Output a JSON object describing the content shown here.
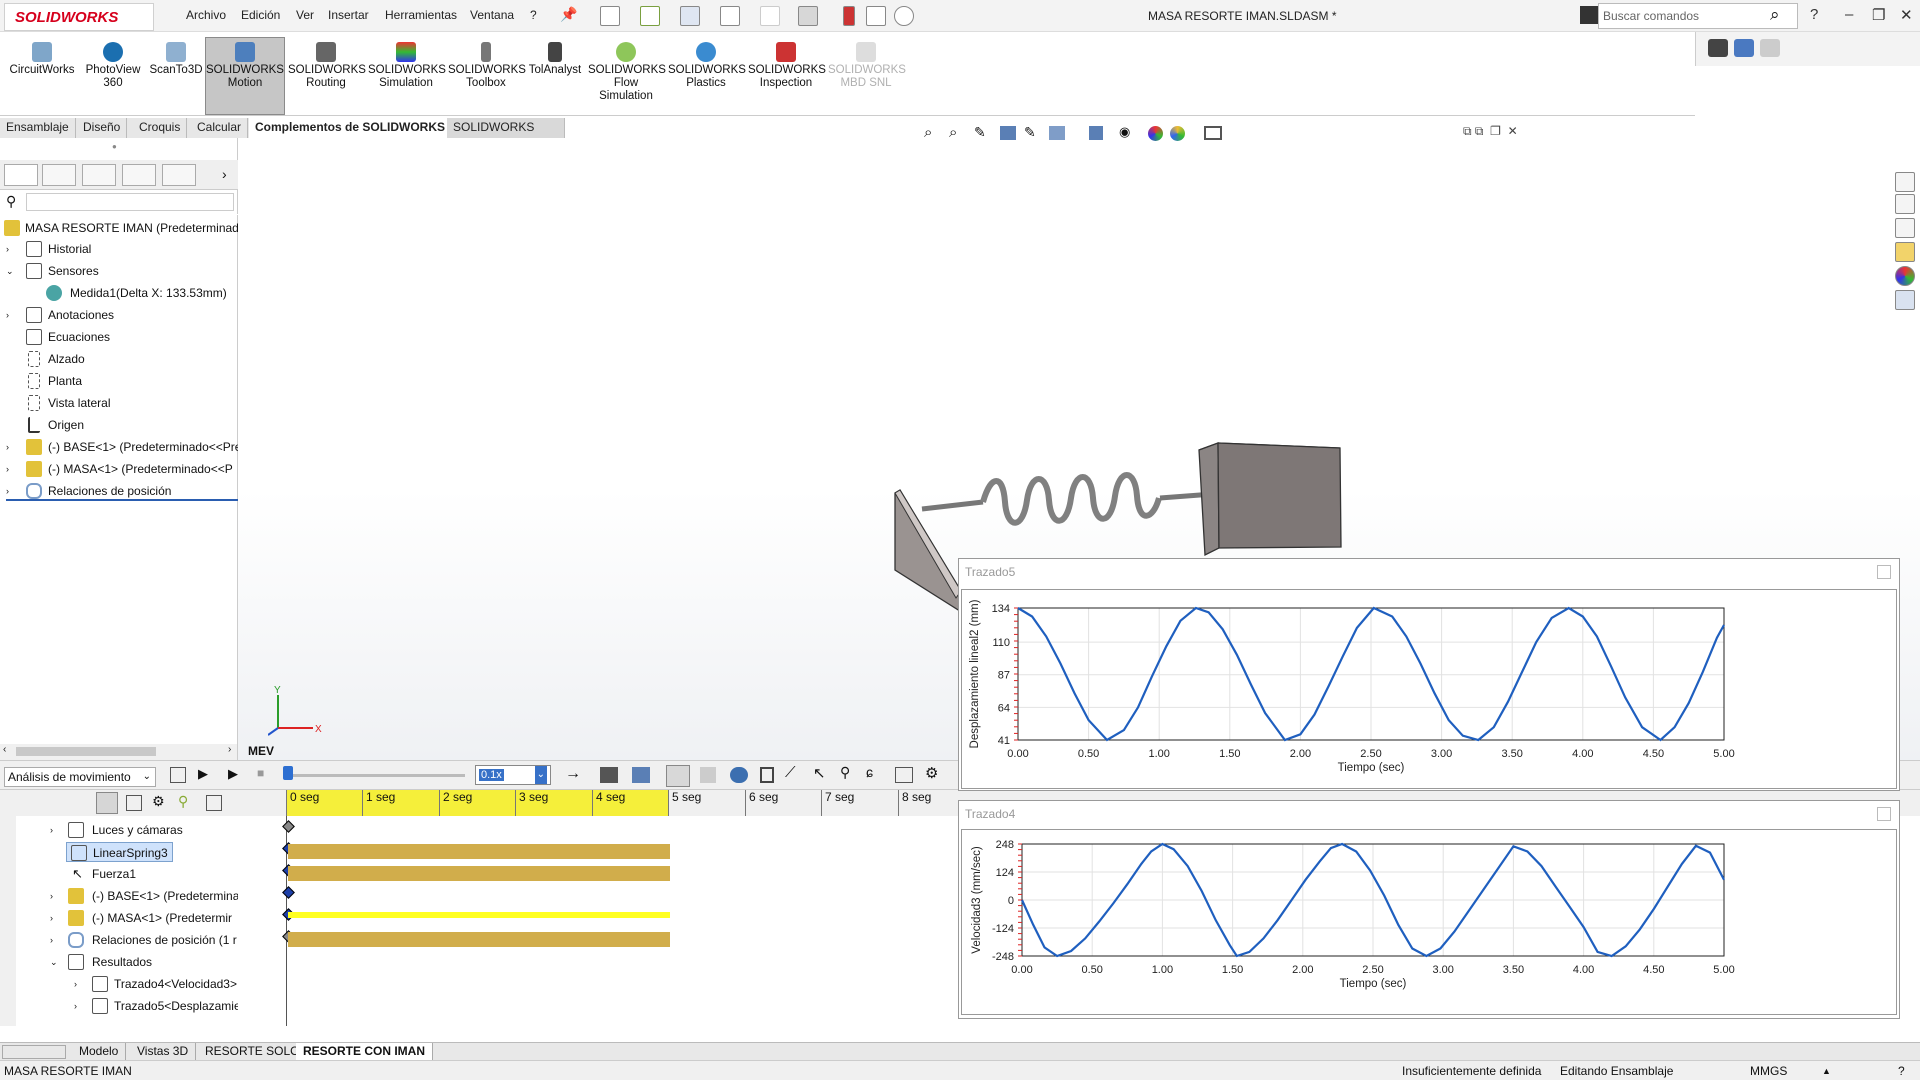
{
  "app": {
    "logo": "SOLIDWORKS",
    "document_title": "MASA RESORTE IMAN.SLDASM *"
  },
  "menu": [
    "Archivo",
    "Edición",
    "Ver",
    "Insertar",
    "Herramientas",
    "Ventana",
    "?"
  ],
  "search": {
    "placeholder": "Buscar comandos"
  },
  "ribbon": [
    {
      "label": "CircuitWorks"
    },
    {
      "label": "PhotoView 360"
    },
    {
      "label": "ScanTo3D"
    },
    {
      "label": "SOLIDWORKS Motion"
    },
    {
      "label": "SOLIDWORKS Routing"
    },
    {
      "label": "SOLIDWORKS Simulation"
    },
    {
      "label": "SOLIDWORKS Toolbox"
    },
    {
      "label": "TolAnalyst"
    },
    {
      "label": "SOLIDWORKS Flow Simulation"
    },
    {
      "label": "SOLIDWORKS Plastics"
    },
    {
      "label": "SOLIDWORKS Inspection"
    },
    {
      "label": "SOLIDWORKS MBD SNL"
    }
  ],
  "tabs": [
    "Ensamblaje",
    "Diseño",
    "Croquis",
    "Calcular",
    "Complementos de SOLIDWORKS",
    "SOLIDWORKS MBD"
  ],
  "tree": {
    "root": "MASA RESORTE IMAN  (Predeterminado",
    "items": [
      "Historial",
      "Sensores",
      "Medida1(Delta X: 133.53mm)",
      "Anotaciones",
      "Ecuaciones",
      "Alzado",
      "Planta",
      "Vista lateral",
      "Origen",
      "(-) BASE<1> (Predeterminado<<Pre",
      "(-) MASA<1> (Predeterminado<<P",
      "Relaciones de posición"
    ]
  },
  "triad": {
    "y": "Y",
    "x": "X"
  },
  "mev_label": "MEV",
  "motion": {
    "study_type": "Análisis de movimiento",
    "speed": "0.1x",
    "time_labels": [
      "0 seg",
      "1 seg",
      "2 seg",
      "3 seg",
      "4 seg",
      "5 seg",
      "6 seg",
      "7 seg",
      "8 seg"
    ],
    "tree": [
      "Luces y cámaras",
      "LinearSpring3",
      "Fuerza1",
      "(-) BASE<1> (Predetermina",
      "(-) MASA<1> (Predetermir",
      "Relaciones de posición (1 r",
      "Resultados",
      "Trazado4<Velocidad3>",
      "Trazado5<Desplazamie"
    ]
  },
  "bottom_tabs": [
    "Modelo",
    "Vistas 3D",
    "RESORTE SOLO",
    "RESORTE CON IMAN"
  ],
  "status": {
    "doc": "MASA RESORTE IMAN",
    "def": "Insuficientemente definida",
    "mode": "Editando Ensamblaje",
    "units": "MMGS"
  },
  "plots": [
    {
      "title": "Trazado5",
      "chart_data": {
        "type": "line",
        "xlabel": "Tiempo (sec)",
        "ylabel": "Desplazamiento lineal2 (mm)",
        "xlim": [
          0,
          5
        ],
        "ylim": [
          41,
          134
        ],
        "xticks": [
          "0.00",
          "0.50",
          "1.00",
          "1.50",
          "2.00",
          "2.50",
          "3.00",
          "3.50",
          "4.00",
          "4.50",
          "5.00"
        ],
        "yticks": [
          "134",
          "110",
          "87",
          "64",
          "41"
        ],
        "series": [
          {
            "color": "#1f5fbf",
            "x": [
              0.0,
              0.1,
              0.2,
              0.3,
              0.4,
              0.5,
              0.63,
              0.75,
              0.85,
              0.95,
              1.05,
              1.15,
              1.26,
              1.35,
              1.45,
              1.55,
              1.65,
              1.75,
              1.89,
              2.0,
              2.1,
              2.2,
              2.3,
              2.4,
              2.52,
              2.65,
              2.75,
              2.85,
              2.95,
              3.05,
              3.15,
              3.26,
              3.37,
              3.47,
              3.57,
              3.67,
              3.78,
              3.9,
              4.0,
              4.1,
              4.2,
              4.3,
              4.42,
              4.55,
              4.65,
              4.75,
              4.85,
              4.95,
              5.0
            ],
            "y": [
              134,
              128,
              114,
              95,
              74,
              55,
              41,
              48,
              64,
              86,
              107,
              125,
              134,
              131,
              119,
              101,
              80,
              60,
              41,
              45,
              59,
              79,
              100,
              120,
              134,
              128,
              114,
              95,
              74,
              55,
              44,
              41,
              50,
              68,
              89,
              110,
              127,
              134,
              128,
              114,
              93,
              71,
              50,
              41,
              50,
              67,
              89,
              113,
              122
            ]
          }
        ]
      }
    },
    {
      "title": "Trazado4",
      "chart_data": {
        "type": "line",
        "xlabel": "Tiempo (sec)",
        "ylabel": "Velocidad3 (mm/sec)",
        "xlim": [
          0,
          5
        ],
        "ylim": [
          -248,
          248
        ],
        "xticks": [
          "0.00",
          "0.50",
          "1.00",
          "1.50",
          "2.00",
          "2.50",
          "3.00",
          "3.50",
          "4.00",
          "4.50",
          "5.00"
        ],
        "yticks": [
          "248",
          "124",
          "0",
          "-124",
          "-248"
        ],
        "series": [
          {
            "color": "#1f5fbf",
            "x": [
              0.0,
              0.08,
              0.16,
              0.25,
              0.35,
              0.45,
              0.55,
              0.65,
              0.75,
              0.85,
              0.92,
              1.0,
              1.08,
              1.18,
              1.28,
              1.38,
              1.48,
              1.53,
              1.62,
              1.72,
              1.82,
              1.92,
              2.02,
              2.12,
              2.2,
              2.28,
              2.38,
              2.48,
              2.58,
              2.68,
              2.78,
              2.88,
              2.98,
              3.08,
              3.18,
              3.28,
              3.38,
              3.5,
              3.6,
              3.7,
              3.8,
              3.9,
              4.0,
              4.1,
              4.2,
              4.3,
              4.4,
              4.5,
              4.6,
              4.7,
              4.8,
              4.9,
              5.0
            ],
            "y": [
              0,
              -110,
              -210,
              -248,
              -226,
              -170,
              -95,
              -15,
              70,
              160,
              215,
              248,
              225,
              150,
              40,
              -90,
              -200,
              -248,
              -230,
              -170,
              -90,
              0,
              90,
              170,
              230,
              248,
              215,
              130,
              20,
              -110,
              -215,
              -248,
              -215,
              -140,
              -50,
              40,
              130,
              238,
              215,
              150,
              60,
              -30,
              -120,
              -230,
              -248,
              -205,
              -130,
              -40,
              60,
              160,
              240,
              210,
              90
            ]
          }
        ]
      }
    }
  ]
}
